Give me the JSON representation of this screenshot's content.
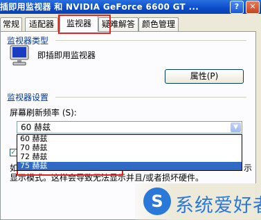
{
  "window": {
    "title": "插即用监视器 和 NVIDIA GeForce 6600 GT  ...",
    "help_label": "?",
    "close_label": "✕"
  },
  "tabs": [
    {
      "label": "常规"
    },
    {
      "label": "适配器"
    },
    {
      "label": "监视器",
      "selected": true
    },
    {
      "label": "疑难解答"
    },
    {
      "label": "颜色管理"
    }
  ],
  "monitor_type": {
    "group_title": "监视器类型",
    "monitor_name": "即插即用监视器",
    "properties_button": "属性(P)"
  },
  "monitor_settings": {
    "group_title": "监视器设置",
    "refresh_label": "屏幕刷新频率 (S):",
    "selected_value": "60 赫兹",
    "options": [
      "60 赫兹",
      "70 赫兹",
      "72 赫兹",
      "75 赫兹"
    ],
    "highlighted_index": 3,
    "checkbox_checked": true,
    "text_line1": "如",
    "text_line1_tail": "示",
    "text_line2": "显示模式。这样会导致无法显示并且/或者损坏硬件。"
  },
  "watermark": {
    "logo_char": "S",
    "text": "系统爱好者"
  },
  "colors": {
    "title_bar": "#0a4bc8",
    "highlight": "#316ac5",
    "annotation_red": "#e8211c",
    "group_title": "#003399"
  }
}
